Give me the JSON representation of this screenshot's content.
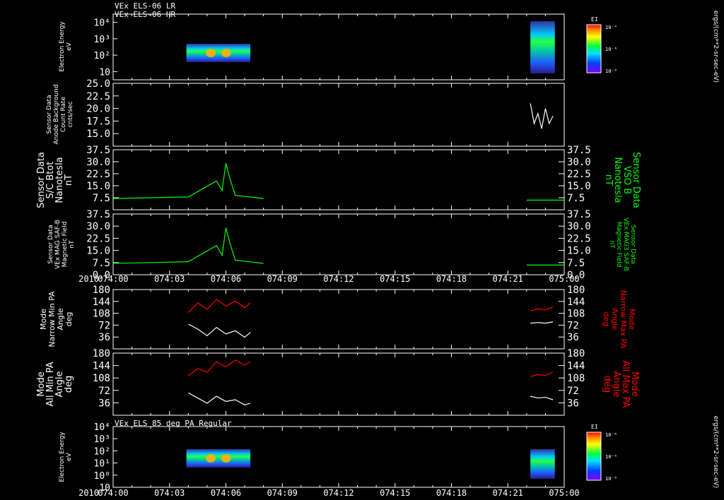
{
  "header": {
    "line1": "VEx ELS-06 LR",
    "line2": "VEx ELS-06 HR"
  },
  "bottom_title": "VEx ELS 85 deg PA Regular",
  "time_axis": {
    "ticks": [
      "074:00",
      "074:03",
      "074:06",
      "074:09",
      "074:12",
      "074:15",
      "074:18",
      "074:21",
      "075:00"
    ],
    "year": "2010"
  },
  "colorbar": {
    "title": "EI",
    "labels": [
      "10⁻⁴",
      "10⁻⁶",
      "10⁻⁸"
    ]
  },
  "side_unit": "ergs/(cm**2-sr-sec-eV)",
  "colors": {
    "green": "#00ff00",
    "red": "#ff0000",
    "white": "#ffffff",
    "background": "#000000"
  },
  "panels": [
    {
      "ylabel": [
        "Electron Energy",
        "eV"
      ]
    },
    {
      "ylabel": [
        "Sensor Data",
        "Anode Background",
        "Count Rate",
        "cnts/sec"
      ]
    },
    {
      "ylabel": [
        "Sensor Data",
        "S/C Btot",
        "Nanotesla",
        "nT"
      ],
      "rlabel": [
        "Sensor Data",
        "VSO B",
        "Nanotesla",
        "nT"
      ]
    },
    {
      "ylabel": [
        "Sensor Data",
        "VEx MAG SAF-B",
        "Magnetic Field",
        "nT"
      ],
      "rlabel": [
        "Sensor Data",
        "VEx MAG3 SAF-B",
        "Magnetic Field",
        "nT"
      ]
    },
    {
      "ylabel": [
        "Mode",
        "Narrow Min PA",
        "Angle",
        "deg"
      ],
      "rlabel": [
        "Mode",
        "Narrow Max PA",
        "Angle",
        "deg"
      ]
    },
    {
      "ylabel": [
        "Mode",
        "All Min PA",
        "Angle",
        "deg"
      ],
      "rlabel": [
        "Mode",
        "All Max PA",
        "Angle",
        "deg"
      ]
    },
    {
      "ylabel": [
        "Electron Energy",
        "eV"
      ]
    }
  ],
  "chart_data": [
    {
      "type": "heatmap",
      "title": "VEx ELS-06 LR / VEx ELS-06 HR",
      "ylabel": "Electron Energy eV",
      "yscale": "log",
      "yticks": [
        "10",
        "10²",
        "10³",
        "10⁴"
      ],
      "blocks": [
        {
          "t_start": "074:03.9",
          "t_end": "074:07.3"
        },
        {
          "t_start": "074:22.2",
          "t_end": "074:23.5"
        }
      ]
    },
    {
      "type": "line",
      "ylabel": "Anode Background Count Rate cnts/sec",
      "ylim": [
        12.5,
        25.0
      ],
      "yticks": [
        "15.0",
        "17.5",
        "20.0",
        "22.5",
        "25.0"
      ],
      "series": [
        {
          "color": "#ffffff",
          "x": [
            "074:22.2",
            "074:22.4",
            "074:22.6",
            "074:22.8",
            "074:23.0",
            "074:23.2",
            "074:23.4"
          ],
          "values": [
            21,
            17,
            19,
            16,
            20,
            17,
            18.5
          ]
        }
      ]
    },
    {
      "type": "line",
      "ylabel": "S/C Btot nT",
      "ylim": [
        0,
        37.5
      ],
      "yticks": [
        "7.5",
        "15.0",
        "22.5",
        "30.0",
        "37.5"
      ],
      "series": [
        {
          "color": "#00ff00",
          "x": [
            "074:00",
            "074:02",
            "074:04",
            "074:05.5",
            "074:05.8",
            "074:06",
            "074:06.2",
            "074:06.5",
            "074:08",
            "074:12",
            "074:18",
            "074:22",
            "074:24"
          ],
          "values": [
            7,
            7.5,
            8,
            18,
            12,
            29,
            20,
            9,
            7,
            7,
            7,
            6,
            6
          ]
        }
      ]
    },
    {
      "type": "line",
      "ylabel": "VEx MAG SAF-B Magnetic Field nT",
      "ylim": [
        0,
        37.5
      ],
      "yticks": [
        "0.0",
        "7.5",
        "15.0",
        "22.5",
        "30.0",
        "37.5"
      ],
      "series": [
        {
          "color": "#00ff00",
          "x": [
            "074:00",
            "074:02",
            "074:04",
            "074:05.5",
            "074:05.8",
            "074:06",
            "074:06.2",
            "074:06.5",
            "074:08",
            "074:12",
            "074:18",
            "074:22",
            "074:24"
          ],
          "values": [
            7,
            7.5,
            8,
            18,
            12,
            29,
            20,
            9,
            7,
            7,
            7,
            6,
            6
          ]
        }
      ]
    },
    {
      "type": "line",
      "ylabel": "Narrow Min PA Angle deg",
      "ylim": [
        0,
        180
      ],
      "yticks": [
        "36",
        "72",
        "108",
        "144",
        "180"
      ],
      "series": [
        {
          "name": "Narrow Max PA",
          "color": "#ff0000",
          "x": [
            "074:04",
            "074:04.5",
            "074:05",
            "074:05.5",
            "074:06",
            "074:06.5",
            "074:07",
            "074:07.3",
            "074:22.2",
            "074:22.6",
            "074:23",
            "074:23.4"
          ],
          "values": [
            110,
            140,
            120,
            150,
            130,
            145,
            125,
            140,
            115,
            122,
            118,
            128
          ]
        },
        {
          "name": "Narrow Min PA",
          "color": "#ffffff",
          "x": [
            "074:04",
            "074:04.5",
            "074:05",
            "074:05.5",
            "074:06",
            "074:06.5",
            "074:07",
            "074:07.3",
            "074:22.2",
            "074:22.6",
            "074:23",
            "074:23.4"
          ],
          "values": [
            75,
            60,
            40,
            65,
            45,
            55,
            35,
            50,
            78,
            80,
            78,
            82
          ]
        }
      ]
    },
    {
      "type": "line",
      "ylabel": "All Min PA Angle deg",
      "ylim": [
        0,
        180
      ],
      "yticks": [
        "36",
        "72",
        "108",
        "144",
        "180"
      ],
      "series": [
        {
          "name": "All Max PA",
          "color": "#ff0000",
          "x": [
            "074:04",
            "074:04.5",
            "074:05",
            "074:05.5",
            "074:06",
            "074:06.5",
            "074:07",
            "074:07.3",
            "074:22.2",
            "074:22.6",
            "074:23",
            "074:23.4"
          ],
          "values": [
            115,
            135,
            125,
            155,
            140,
            160,
            145,
            155,
            112,
            118,
            115,
            125
          ]
        },
        {
          "name": "All Min PA",
          "color": "#ffffff",
          "x": [
            "074:04",
            "074:04.5",
            "074:05",
            "074:05.5",
            "074:06",
            "074:06.5",
            "074:07",
            "074:07.3",
            "074:22.2",
            "074:22.6",
            "074:23",
            "074:23.4"
          ],
          "values": [
            65,
            50,
            35,
            55,
            40,
            45,
            30,
            35,
            55,
            50,
            52,
            45
          ]
        }
      ]
    },
    {
      "type": "heatmap",
      "title": "VEx ELS 85 deg PA Regular",
      "ylabel": "Electron Energy eV",
      "yscale": "log",
      "yticks": [
        "10",
        "10⁰",
        "10¹",
        "10²",
        "10³",
        "10⁴"
      ],
      "blocks": [
        {
          "t_start": "074:03.9",
          "t_end": "074:07.3"
        },
        {
          "t_start": "074:22.2",
          "t_end": "074:23.5"
        }
      ]
    }
  ]
}
